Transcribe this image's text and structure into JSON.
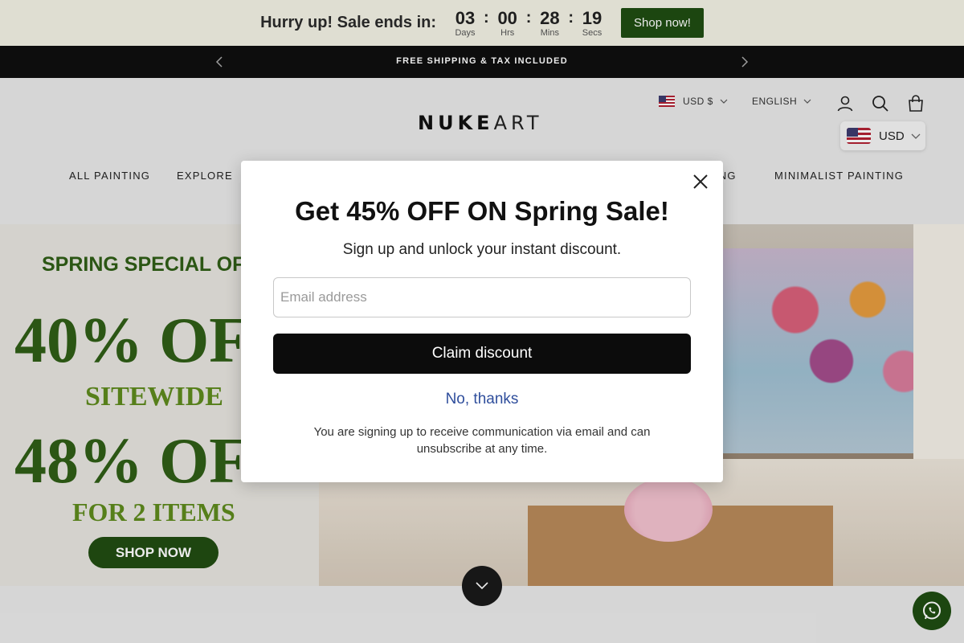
{
  "countdown": {
    "headline": "Hurry up! Sale ends in:",
    "days": "03",
    "days_label": "Days",
    "hours": "00",
    "hours_label": "Hrs",
    "minutes": "28",
    "minutes_label": "Mins",
    "seconds": "19",
    "seconds_label": "Secs",
    "separator": ":",
    "cta": "Shop now!"
  },
  "announcement": {
    "text": "FREE SHIPPING & TAX INCLUDED",
    "prev_icon": "chevron-left-icon",
    "next_icon": "chevron-right-icon"
  },
  "header": {
    "logo_bold": "NUKE",
    "logo_light": "ART",
    "currency": "USD $",
    "language": "ENGLISH",
    "currency_selector": "USD",
    "icons": [
      "account-icon",
      "search-icon",
      "cart-icon"
    ]
  },
  "nav": {
    "items": [
      "ALL PAINTING",
      "EXPLORE",
      "ING",
      "MINIMALIST PAINTING"
    ]
  },
  "hero": {
    "line1": "SPRING SPECIAL OF",
    "line2": "40% OF",
    "line3": "SITEWIDE",
    "line4": "48% OF",
    "line5": "FOR 2 ITEMS",
    "cta": "SHOP NOW"
  },
  "popup": {
    "title": "Get 45% OFF ON Spring Sale!",
    "subtitle": "Sign up and unlock your instant discount.",
    "email_placeholder": "Email address",
    "email_value": "",
    "claim_button": "Claim discount",
    "decline": "No, thanks",
    "disclaimer": "You are signing up to receive communication via email and can unsubscribe at any time."
  },
  "colors": {
    "countdown_bg": "#f2f1e4",
    "shop_now_button": "#1f4d12",
    "announcement_bg": "#0f0f0f",
    "hero_green": "#2f5e16",
    "claim_button": "#0c0c0c",
    "link_blue": "#2f4e9c"
  }
}
